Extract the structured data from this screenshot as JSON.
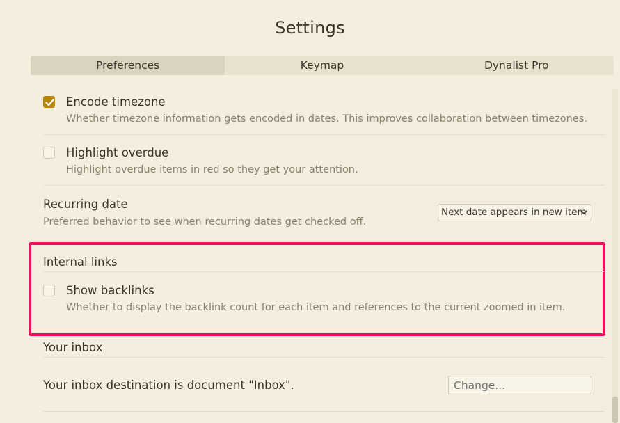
{
  "dialog": {
    "title": "Settings"
  },
  "tabs": [
    {
      "label": "Preferences",
      "active": true
    },
    {
      "label": "Keymap",
      "active": false
    },
    {
      "label": "Dynalist Pro",
      "active": false
    }
  ],
  "settings": {
    "encode_timezone": {
      "label": "Encode timezone",
      "description": "Whether timezone information gets encoded in dates. This improves collaboration between timezones.",
      "checked": true
    },
    "highlight_overdue": {
      "label": "Highlight overdue",
      "description": "Highlight overdue items in red so they get your attention.",
      "checked": false
    },
    "recurring_date": {
      "label": "Recurring date",
      "description": "Preferred behavior to see when recurring dates get checked off.",
      "selected_value": "Next date appears in new item"
    },
    "internal_links": {
      "section_title": "Internal links",
      "show_backlinks": {
        "label": "Show backlinks",
        "description": "Whether to display the backlink count for each item and references to the current zoomed in item.",
        "checked": false
      }
    },
    "your_inbox": {
      "section_title": "Your inbox",
      "destination_text": "Your inbox destination is document \"Inbox\".",
      "change_placeholder": "Change..."
    }
  },
  "colors": {
    "background": "#f3eedd",
    "accent_checkbox": "#b8860b",
    "highlight_border": "#f0105e",
    "text": "#3b3228",
    "muted_text": "#8a8170"
  }
}
